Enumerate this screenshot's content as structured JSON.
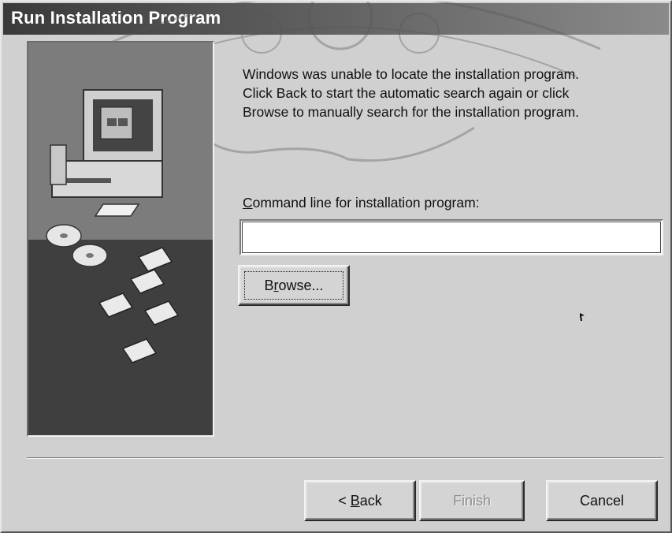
{
  "window": {
    "title": "Run Installation Program"
  },
  "message": {
    "lines": [
      "Windows was unable to locate the installation program.",
      "Click Back to start the automatic search again or click",
      "Browse to manually search for the installation program."
    ]
  },
  "command_line": {
    "label_accel": "C",
    "label_rest": "ommand line for installation program:",
    "value": ""
  },
  "buttons": {
    "browse_accel": "r",
    "browse_pre": "B",
    "browse_post": "owse...",
    "back_prefix": "< ",
    "back_accel": "B",
    "back_rest": "ack",
    "finish": "Finish",
    "cancel": "Cancel"
  },
  "colors": {
    "titlebar": "#3a3a3a",
    "dialog_bg": "#d0d0d0",
    "panel_top": "#7a7a7a",
    "panel_bottom": "#3e3e3e"
  }
}
